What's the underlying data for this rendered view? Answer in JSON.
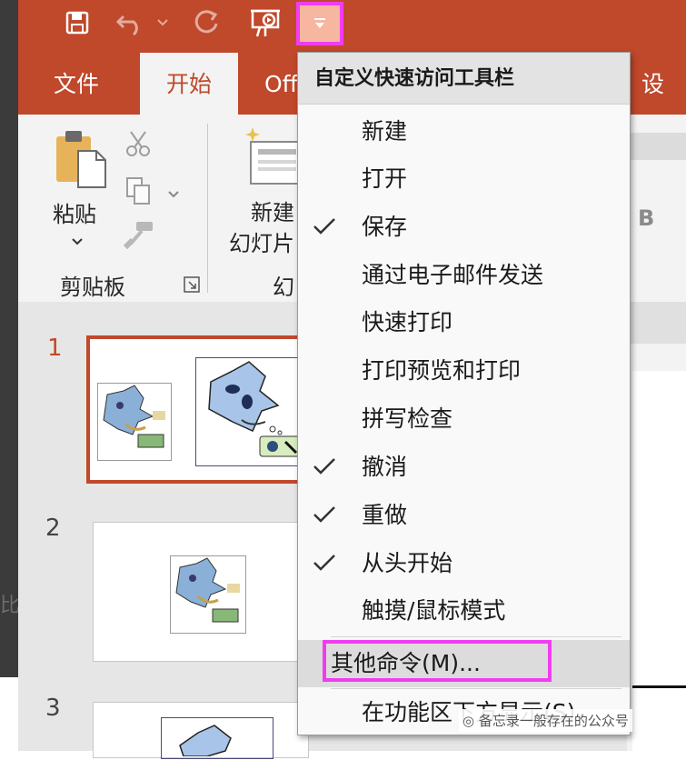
{
  "quick_access": {
    "icons": [
      "save-icon",
      "undo-icon",
      "redo-icon",
      "slideshow-from-beginning-icon",
      "customize-dropdown-icon"
    ]
  },
  "tabs": [
    {
      "label": "文件"
    },
    {
      "label": "开始"
    },
    {
      "label": "Offi"
    },
    {
      "label": "设计"
    }
  ],
  "ribbon": {
    "paste_label": "粘贴",
    "clipboard_group": "剪贴板",
    "new_slide_line1": "新建",
    "new_slide_line2": "幻灯片",
    "slides_group_partial": "幻",
    "bold_letter": "B"
  },
  "slides": [
    {
      "number": "1"
    },
    {
      "number": "2"
    },
    {
      "number": "3"
    }
  ],
  "menu": {
    "title": "自定义快速访问工具栏",
    "items": [
      {
        "label": "新建",
        "checked": false
      },
      {
        "label": "打开",
        "checked": false
      },
      {
        "label": "保存",
        "checked": true
      },
      {
        "label": "通过电子邮件发送",
        "checked": false
      },
      {
        "label": "快速打印",
        "checked": false
      },
      {
        "label": "打印预览和打印",
        "checked": false
      },
      {
        "label": "拼写检查",
        "checked": false
      },
      {
        "label": "撤消",
        "checked": true
      },
      {
        "label": "重做",
        "checked": true
      },
      {
        "label": "从头开始",
        "checked": true
      },
      {
        "label": "触摸/鼠标模式",
        "checked": false
      },
      {
        "label": "其他命令(M)...",
        "checked": false
      },
      {
        "label": "在功能区下方显示(S)",
        "checked": false
      }
    ]
  },
  "watermark": "备忘录一般存在的公众号",
  "colors": {
    "accent": "#c0482b",
    "highlight_box": "#f03df0",
    "dropdown_active_bg": "#f7b69f"
  }
}
